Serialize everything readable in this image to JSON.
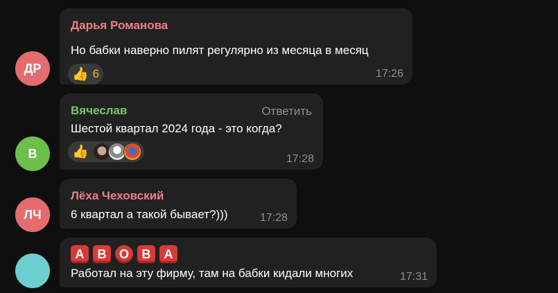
{
  "messages": [
    {
      "initials": "ДР",
      "avatar_color": "#e46c6f",
      "sender": "Дарья Романова",
      "sender_color": "#f07f86",
      "text": "Но бабки наверно пилят регулярно из месяца в месяц",
      "reaction_emoji": "👍",
      "reaction_count": "6",
      "time": "17:26"
    },
    {
      "initials": "В",
      "avatar_color": "#6bbf4a",
      "sender": "Вячеслав",
      "sender_color": "#78c96b",
      "reply_label": "Ответить",
      "text": "Шестой квартал 2024 года - это когда?",
      "reaction_emoji": "👍",
      "time": "17:28"
    },
    {
      "initials": "ЛЧ",
      "avatar_color": "#e46c6f",
      "sender": "Лёха Чеховский",
      "sender_color": "#f07f86",
      "text": "6 квартал а такой бывает?)))",
      "time": "17:28"
    },
    {
      "initials": "",
      "avatar_color": "#6ccfcf",
      "sender_tiles": [
        "A",
        "B",
        "O",
        "B",
        "A"
      ],
      "text": "Работал на эту фирму, там на бабки кидали многих",
      "time": "17:31"
    }
  ]
}
